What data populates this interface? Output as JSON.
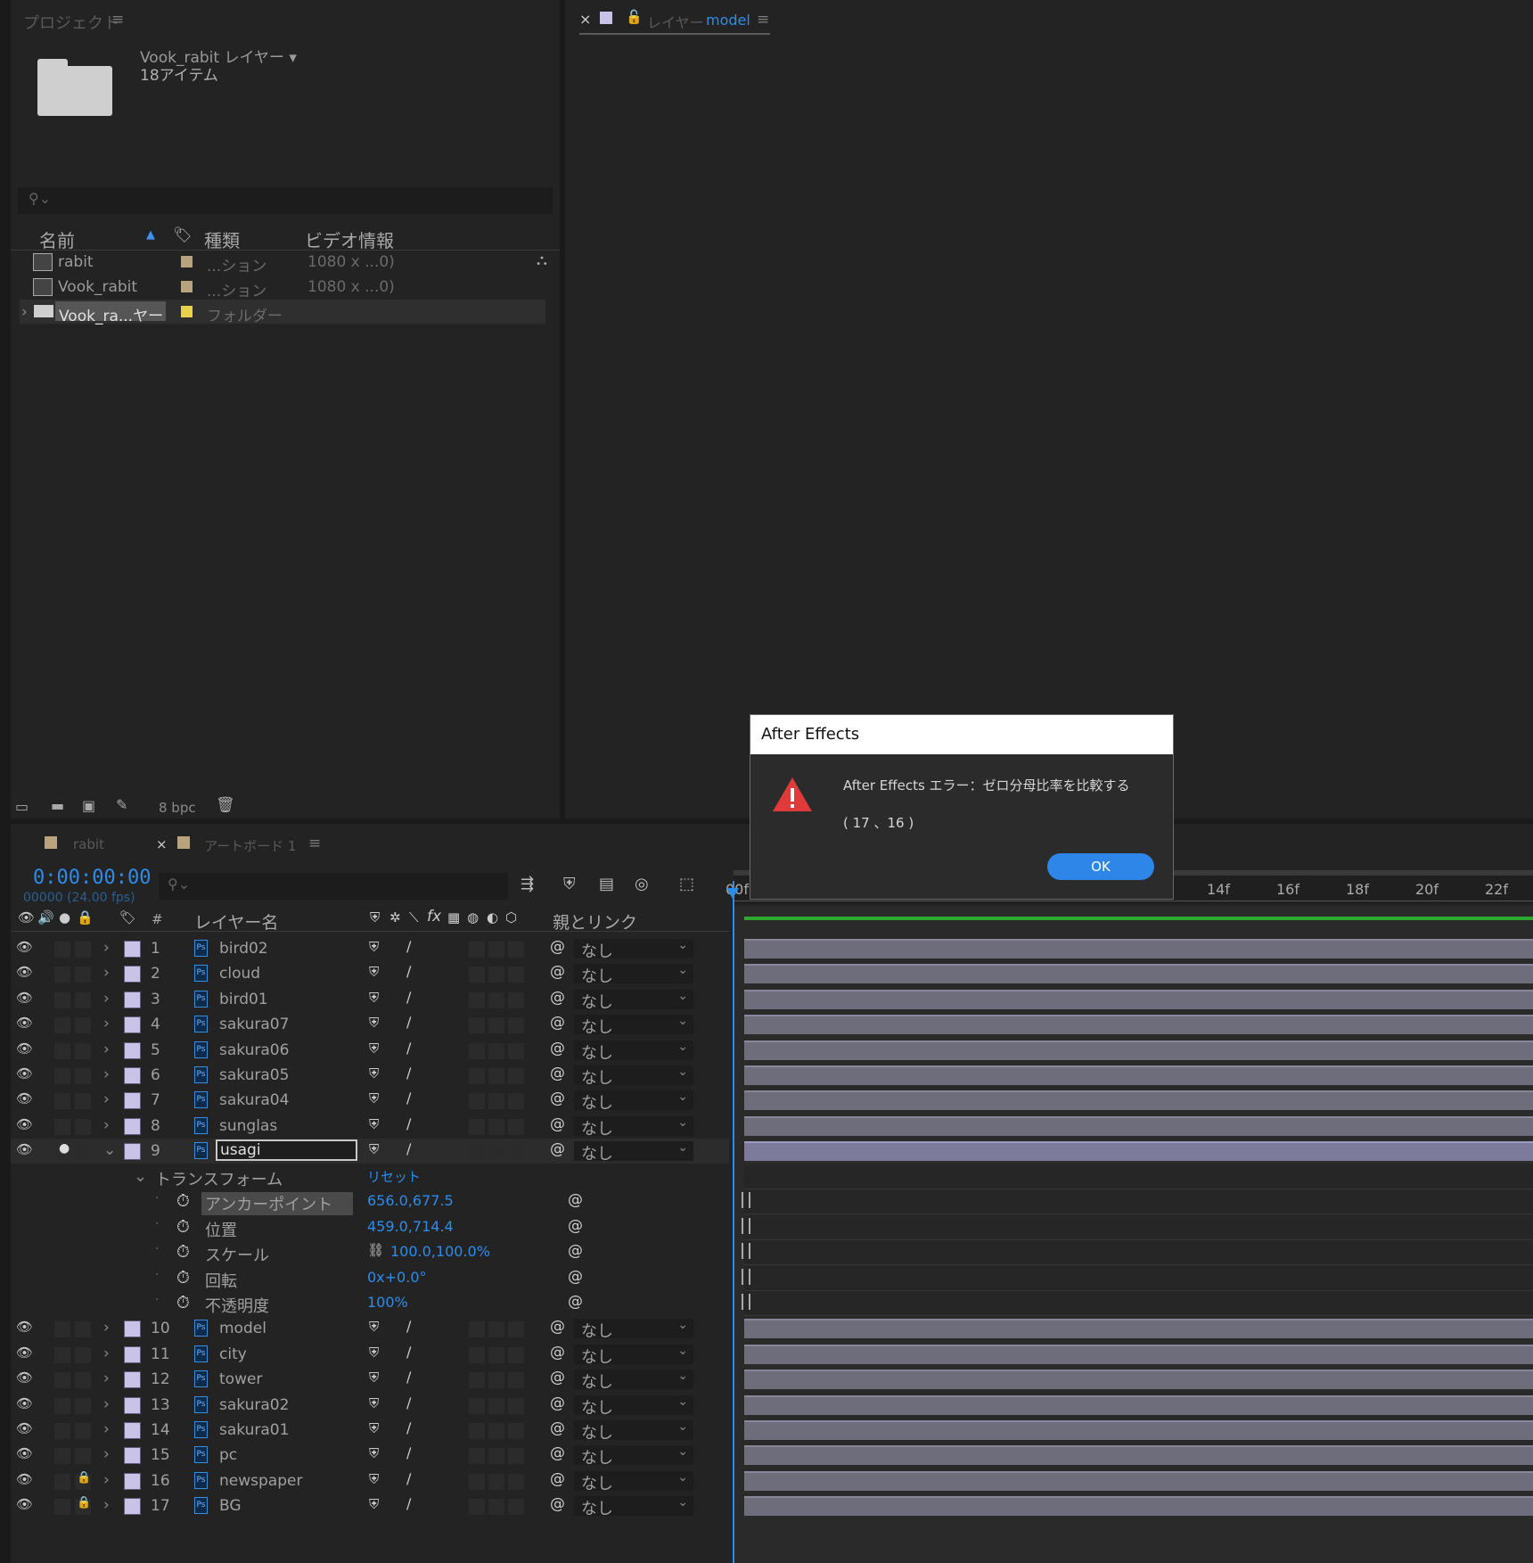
{
  "project": {
    "title": "プロジェクト",
    "menu": "≡",
    "folder_name": "Vook_rabit レイヤー ▾",
    "item_count": "18アイテム",
    "columns": [
      "名前",
      "種類",
      "ビデオ情報"
    ],
    "rows": [
      {
        "name": "rabit",
        "type": "...ション",
        "video": "1080 x ...0)",
        "swatch": "#b9a27e"
      },
      {
        "name": "Vook_rabit",
        "type": "...ション",
        "video": "1080 x ...0)",
        "swatch": "#b9a27e"
      },
      {
        "name": "Vook_ra...ヤー",
        "type": "フォルダー",
        "video": "",
        "swatch": "#e8d24a"
      }
    ],
    "bpc": "8 bpc"
  },
  "layer_viewer": {
    "close": "×",
    "label": "レイヤー",
    "name": "model",
    "menu": "≡"
  },
  "timeline": {
    "tab1": "rabit",
    "tab2_close": "×",
    "tab2": "アートボード 1",
    "menu": "≡",
    "timecode": "0:00:00:00",
    "fps": "00000 (24.00 fps)",
    "col_hash": "#",
    "col_layer_name": "レイヤー名",
    "col_fx": "fx",
    "col_parent": "親とリンク",
    "ruler": [
      "00f",
      "14f",
      "16f",
      "18f",
      "20f",
      "22f"
    ],
    "layers": [
      {
        "num": "1",
        "name": "bird02",
        "parent": "なし",
        "locked": false
      },
      {
        "num": "2",
        "name": "cloud",
        "parent": "なし",
        "locked": false
      },
      {
        "num": "3",
        "name": "bird01",
        "parent": "なし",
        "locked": false
      },
      {
        "num": "4",
        "name": "sakura07",
        "parent": "なし",
        "locked": false
      },
      {
        "num": "5",
        "name": "sakura06",
        "parent": "なし",
        "locked": false
      },
      {
        "num": "6",
        "name": "sakura05",
        "parent": "なし",
        "locked": false
      },
      {
        "num": "7",
        "name": "sakura04",
        "parent": "なし",
        "locked": false
      },
      {
        "num": "8",
        "name": "sunglas",
        "parent": "なし",
        "locked": false
      },
      {
        "num": "9",
        "name": "usagi",
        "parent": "なし",
        "locked": false,
        "selected": true
      }
    ],
    "transform": {
      "label": "トランスフォーム",
      "reset": "リセット",
      "props": [
        {
          "name": "アンカーポイント",
          "value": "656.0,677.5"
        },
        {
          "name": "位置",
          "value": "459.0,714.4"
        },
        {
          "name": "スケール",
          "value": "100.0,100.0%"
        },
        {
          "name": "回転",
          "value": "0x+0.0°"
        },
        {
          "name": "不透明度",
          "value": "100%"
        }
      ]
    },
    "layers_after": [
      {
        "num": "10",
        "name": "model",
        "parent": "なし",
        "locked": false
      },
      {
        "num": "11",
        "name": "city",
        "parent": "なし",
        "locked": false
      },
      {
        "num": "12",
        "name": "tower",
        "parent": "なし",
        "locked": false
      },
      {
        "num": "13",
        "name": "sakura02",
        "parent": "なし",
        "locked": false
      },
      {
        "num": "14",
        "name": "sakura01",
        "parent": "なし",
        "locked": false
      },
      {
        "num": "15",
        "name": "pc",
        "parent": "なし",
        "locked": false
      },
      {
        "num": "16",
        "name": "newspaper",
        "parent": "なし",
        "locked": true
      },
      {
        "num": "17",
        "name": "BG",
        "parent": "なし",
        "locked": true
      }
    ]
  },
  "dialog": {
    "title": "After Effects",
    "message": "After Effects エラー：ゼロ分母比率を比較する",
    "code": "( 17 、16 )",
    "ok": "OK"
  },
  "colors": {
    "accent": "#2d8ceb",
    "warning": "#e03a3a",
    "layer_swatch": "#c9c3e8",
    "work_area": "#2fa830"
  }
}
